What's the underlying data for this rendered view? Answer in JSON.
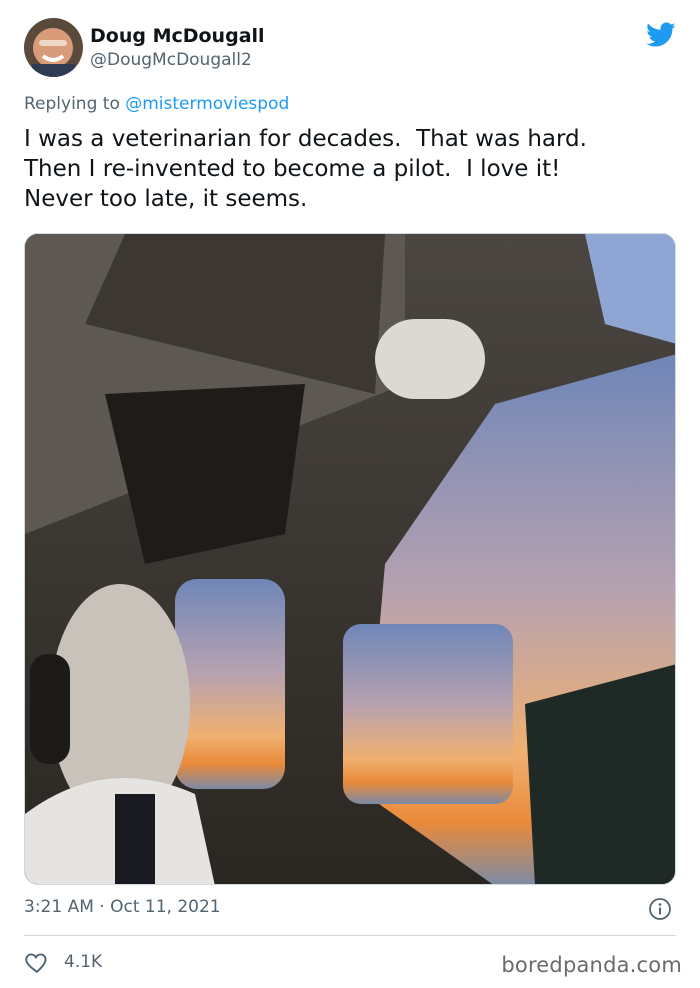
{
  "author": {
    "display_name": "Doug McDougall",
    "handle": "@DougMcDougall2"
  },
  "reply": {
    "prefix": "Replying to ",
    "to_handle": "@mistermoviespod"
  },
  "tweet": {
    "lines": [
      "I was a veterinarian for decades.  That was hard.",
      "Then I re-invented to become a pilot.  I love it!",
      "Never too late, it seems."
    ]
  },
  "meta": {
    "timestamp": "3:21 AM · Oct 11, 2021"
  },
  "engagement": {
    "likes": "4.1K"
  },
  "watermark": "boredpanda.com",
  "colors": {
    "twitter_blue": "#1d9bf0",
    "secondary_text": "#536471"
  },
  "icons": {
    "brand": "twitter-bird-icon",
    "info": "info-icon",
    "like": "heart-icon"
  }
}
